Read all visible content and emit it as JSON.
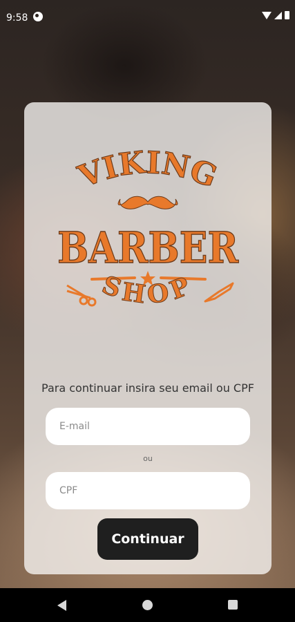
{
  "status_bar": {
    "time": "9:58",
    "icons": [
      "app-notification-icon",
      "wifi-icon",
      "signal-icon",
      "battery-icon"
    ]
  },
  "logo": {
    "line1": "VIKING",
    "line2": "BARBER",
    "line3": "SHOP",
    "color": "#e8792b",
    "outline_color": "#6b3a1a",
    "icons": [
      "mustache-icon",
      "star-icon",
      "scissors-icon",
      "razor-icon"
    ]
  },
  "login": {
    "prompt": "Para continuar insira seu email ou CPF",
    "email_placeholder": "E-mail",
    "or_label": "ou",
    "cpf_placeholder": "CPF",
    "continue_label": "Continuar"
  },
  "colors": {
    "button_bg": "#1f1f1f",
    "card_bg": "#f5f2f0"
  },
  "nav_bar": {
    "icons": [
      "back-icon",
      "home-icon",
      "recents-icon"
    ]
  }
}
